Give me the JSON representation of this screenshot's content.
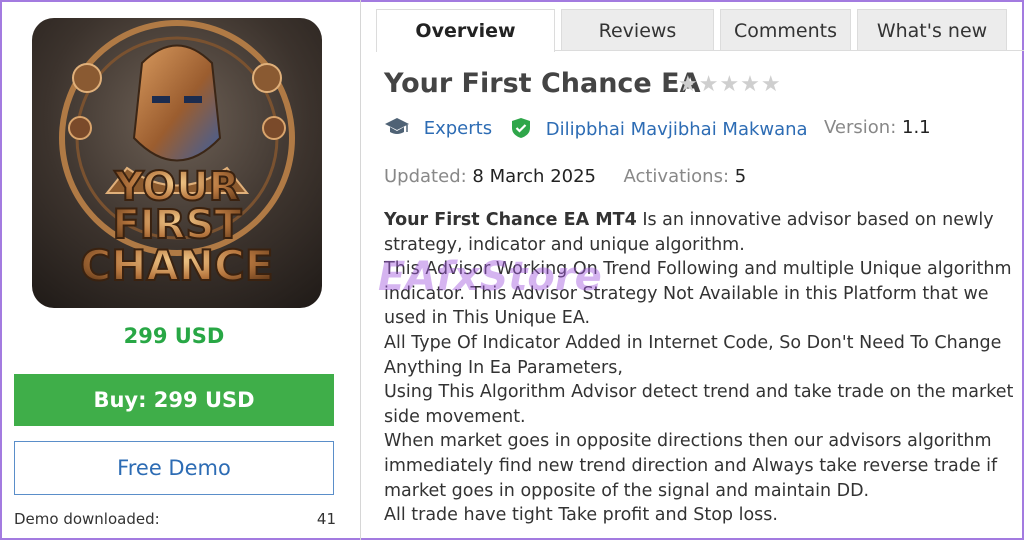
{
  "product": {
    "image_alt": "YOUR FIRST CHANCE",
    "image_lines": [
      "YOUR",
      "FIRST",
      "CHANCE"
    ],
    "price": "299 USD",
    "buy_label": "Buy: 299 USD",
    "demo_label": "Free Demo",
    "demo_downloaded_label": "Demo downloaded:",
    "demo_downloaded_count": "41"
  },
  "tabs": [
    "Overview",
    "Reviews",
    "Comments",
    "What's new"
  ],
  "active_tab": "Overview",
  "header": {
    "title": "Your First Chance EA",
    "stars": "★★★★★",
    "rating": 0,
    "category": "Experts",
    "author": "Dilipbhai Mavjibhai Makwana",
    "version_label": "Version:",
    "version_value": "1.1",
    "updated_label": "Updated:",
    "updated_value": "8 March 2025",
    "activations_label": "Activations:",
    "activations_value": "5"
  },
  "description": {
    "bold_lead": "Your First Chance EA MT4",
    "line1_rest": " Is an innovative advisor based on newly strategy, indicator and unique algorithm.",
    "paragraphs": [
      "This Advisor Working On Trend Following and multiple Unique algorithm indicator. This Advisor Strategy Not Available in this Platform that we used in This Unique EA.",
      "All Type Of Indicator Added in Internet Code, So Don't Need To Change Anything In Ea Parameters,",
      "Using This Algorithm Advisor detect trend and take trade on the market side movement.",
      "When market goes in opposite directions then our advisors algorithm immediately find new trend direction and Always take reverse trade if market goes in opposite of the signal and maintain DD.",
      "All trade have tight Take profit and Stop loss."
    ]
  },
  "watermark": {
    "text": "EAfxStore"
  },
  "colors": {
    "buy": "#3fae49",
    "price": "#28a745",
    "link": "#2d6cb4",
    "frame": "#a37be0"
  },
  "icons": {
    "category": "graduation-cap-icon",
    "author": "verified-shield-icon"
  }
}
